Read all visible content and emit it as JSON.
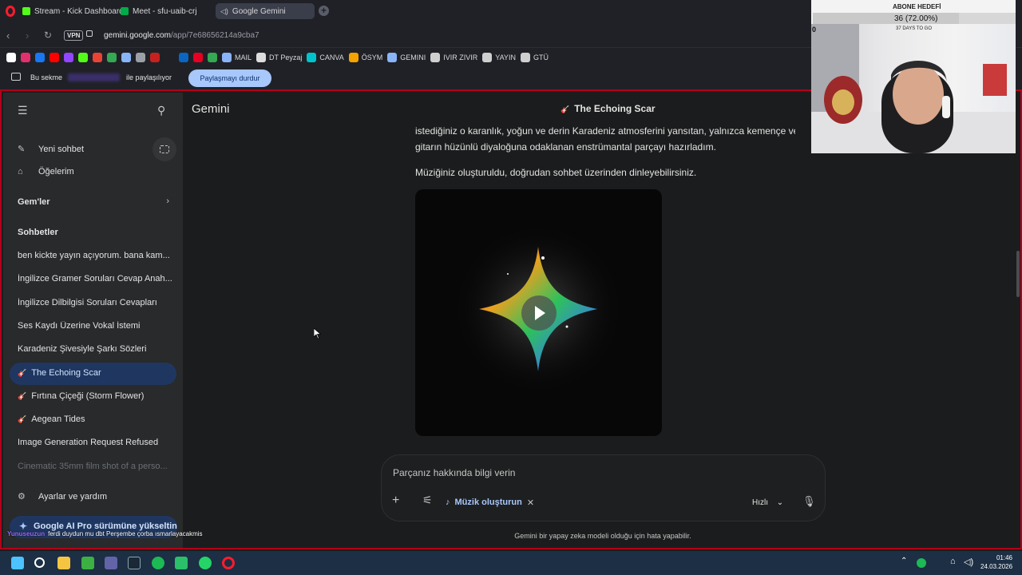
{
  "browser": {
    "tabs": [
      {
        "label": "Stream - Kick Dashboard",
        "icon": "kick-icon",
        "color": "#53fc18"
      },
      {
        "label": "Meet - sfu-uaib-crj",
        "icon": "meet-icon",
        "color": "#00ac47"
      },
      {
        "label": "Google Gemini",
        "icon": "gemini-icon",
        "color": "#8ab4f8",
        "active": true
      }
    ],
    "url_host": "gemini.google.com",
    "url_path": "/app/7e68656214a9cba7",
    "vpn_label": "VPN",
    "bookmarks": [
      {
        "label": "",
        "icon": "x-icon",
        "color": "#ffffff"
      },
      {
        "label": "",
        "icon": "instagram-icon",
        "color": "#e1306c"
      },
      {
        "label": "",
        "icon": "facebook-icon",
        "color": "#1877f2"
      },
      {
        "label": "",
        "icon": "youtube-icon",
        "color": "#ff0000"
      },
      {
        "label": "",
        "icon": "twitch-icon",
        "color": "#9146ff"
      },
      {
        "label": "",
        "icon": "kick-icon",
        "color": "#53fc18"
      },
      {
        "label": "",
        "icon": "gmail-icon",
        "color": "#ea4335"
      },
      {
        "label": "",
        "icon": "maps-icon",
        "color": "#34a853"
      },
      {
        "label": "",
        "icon": "dollar-icon",
        "color": "#8ab4f8"
      },
      {
        "label": "",
        "icon": "link-icon",
        "color": "#9aa0a6"
      },
      {
        "label": "",
        "icon": "box-icon",
        "color": "#c5221f"
      },
      {
        "label": "",
        "icon": "globe-icon",
        "color": "#202127"
      },
      {
        "label": "",
        "icon": "linkedin-icon",
        "color": "#0a66c2"
      },
      {
        "label": "",
        "icon": "pinterest-icon",
        "color": "#e60023"
      },
      {
        "label": "",
        "icon": "phone-icon",
        "color": "#34a853"
      },
      {
        "label": "MAIL",
        "icon": "mail-icon",
        "color": "#8ab4f8"
      },
      {
        "label": "DT Peyzaj",
        "icon": "dt-icon",
        "color": "#dddddd"
      },
      {
        "label": "CANVA",
        "icon": "canva-icon",
        "color": "#00c4cc"
      },
      {
        "label": "ÖSYM",
        "icon": "osym-icon",
        "color": "#f4a300"
      },
      {
        "label": "GEMINI",
        "icon": "gemini-icon",
        "color": "#8ab4f8"
      },
      {
        "label": "IVIR ZIVIR",
        "icon": "folder-icon",
        "color": "#cfcfcf"
      },
      {
        "label": "YAYIN",
        "icon": "folder-icon",
        "color": "#cfcfcf"
      },
      {
        "label": "GTÜ",
        "icon": "folder-icon",
        "color": "#cfcfcf"
      }
    ],
    "share": {
      "prefix": "Bu sekme",
      "suffix": "ile paylaşılıyor",
      "stop_button": "Paylaşmayı durdur"
    }
  },
  "sidebar": {
    "new_chat": "Yeni sohbet",
    "my_items": "Öğelerim",
    "gems": "Gem'ler",
    "chats_heading": "Sohbetler",
    "chats": [
      {
        "label": "ben kickte yayın açıyorum. bana kam...",
        "music": false
      },
      {
        "label": "İngilizce Gramer Soruları Cevap Anah...",
        "music": false
      },
      {
        "label": "İngilizce Dilbilgisi Soruları Cevapları",
        "music": false
      },
      {
        "label": "Ses Kaydı Üzerine Vokal İstemi",
        "music": false
      },
      {
        "label": "Karadeniz Şivesiyle Şarkı Sözleri",
        "music": false
      },
      {
        "label": "The Echoing Scar",
        "music": true,
        "active": true
      },
      {
        "label": "Fırtına Çiçeği (Storm Flower)",
        "music": true
      },
      {
        "label": "Aegean Tides",
        "music": true
      },
      {
        "label": "Image Generation Request Refused",
        "music": false
      },
      {
        "label": "Cinematic 35mm film shot of a perso...",
        "music": false,
        "faded": true
      }
    ],
    "settings": "Ayarlar ve yardım",
    "upgrade": "Google AI Pro sürümüne yükseltin"
  },
  "stream_chat": {
    "user": "Yunuseuzun",
    "message": "ferdi duydun mu dbt Perşembe çorba ısmarlayacakmis"
  },
  "main": {
    "brand": "Gemini",
    "conversation_title": "The Echoing Scar",
    "message_line1": "istediğiniz o karanlık, yoğun ve derin Karadeniz atmosferini yansıtan, yalnızca kemençe ve",
    "message_line2": "gitarın hüzünlü diyaloğuna odaklanan enstrümantal parçayı hazırladım.",
    "message_line3": "Müziğiniz oluşturuldu, doğrudan sohbet üzerinden dinleyebilirsiniz.",
    "input_placeholder": "Parçanız hakkında bilgi verin",
    "tool_chip": "Müzik oluşturun",
    "model_mode": "Hızlı",
    "disclaimer": "Gemini bir yapay zeka modeli olduğu için hata yapabilir."
  },
  "overlay": {
    "subscriber_goal_label": "ABONE HEDEFİ",
    "subscriber_count": "36 (72.00%)",
    "subscriber_progress": 0.72,
    "days_to_go": "37 DAYS TO GO",
    "zero_label": "0"
  },
  "taskbar": {
    "time": "01:46",
    "date": "24.03.2026"
  }
}
